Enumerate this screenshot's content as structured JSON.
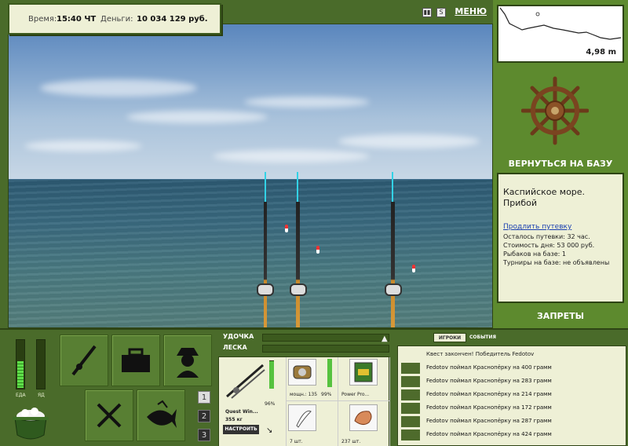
{
  "topbar": {
    "time_label": "Время:",
    "time_value": "15:40 ЧТ",
    "money_label": "Деньги:",
    "money_value": "10 034 129 руб."
  },
  "menu": {
    "label": "МЕНЮ",
    "pause_icon": "pause-icon",
    "sound_icon": "sound-icon"
  },
  "depth": {
    "value": "4,98 m"
  },
  "right_panel": {
    "return_label": "ВЕРНУТЬСЯ НА БАЗУ",
    "location_title": "Каспийское море. Прибой",
    "extend_link": "Продлить путевку",
    "info_lines": [
      "Осталось путевки: 32 час.",
      "Стоимость дня: 53 000 руб.",
      "Рыбаков на базе: 1",
      "Турниры на базе: не объявлены"
    ],
    "bans_label": "ЗАПРЕТЫ"
  },
  "meters": {
    "food_label": "ЕДА",
    "poison_label": "ЯД",
    "food_level": 0.55,
    "poison_level": 0.0
  },
  "slots": [
    "1",
    "2",
    "3"
  ],
  "gear": {
    "rod_label": "УДОЧКА",
    "line_label": "ЛЕСКА",
    "rod_name": "Quest Win...",
    "rod_weight": "355 кг",
    "rod_pct": "96%",
    "rod_level": 0.96,
    "reel_pct": "99%",
    "reel_level": 0.99,
    "reel_power": "мощн.: 135",
    "line_name": "Power Pro...",
    "hook_count": "7 шт.",
    "bait_count": "237 шт.",
    "setup_label": "НАСТРОИТЬ"
  },
  "chat": {
    "tab_players": "ИГРОКИ",
    "tab_events": "СОБЫТИЯ",
    "quest_line": "Квест закончен! Победитель Fedotov",
    "messages": [
      "Fedotov поймал Краснопёрку на 400 грамм",
      "Fedotov поймал Краснопёрку на 283 грамм",
      "Fedotov поймал Краснопёрку на 214 грамм",
      "Fedotov поймал Краснопёрку на 172 грамм",
      "Fedotov поймал Краснопёрку на 287 грамм",
      "Fedotov поймал Краснопёрку на 424 грамм"
    ]
  },
  "colors": {
    "panel": "#5d8a2e",
    "cream": "#eef0d6",
    "dark": "#2e4415"
  }
}
